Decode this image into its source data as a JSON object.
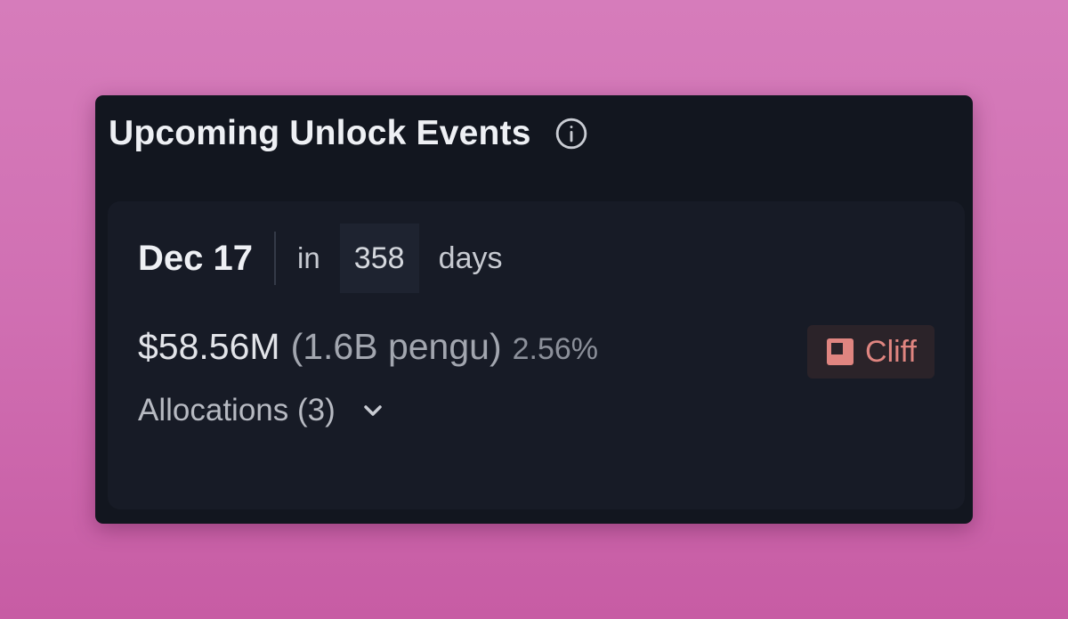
{
  "card": {
    "title": "Upcoming Unlock Events",
    "info_icon": "info-circle-icon"
  },
  "event": {
    "date": "Dec 17",
    "in_label": "in",
    "days_value": "358",
    "days_label": "days",
    "amount_usd": "$58.56M",
    "amount_tokens": "(1.6B pengu)",
    "percent": "2.56%",
    "badge": {
      "label": "Cliff",
      "icon": "cliff-icon",
      "color": "#e08580"
    },
    "allocations_label": "Allocations (3)",
    "allocations_icon": "chevron-down-icon"
  },
  "colors": {
    "card_background": "#12161f",
    "panel_background": "#171b26",
    "badge_background": "#2b2329"
  }
}
